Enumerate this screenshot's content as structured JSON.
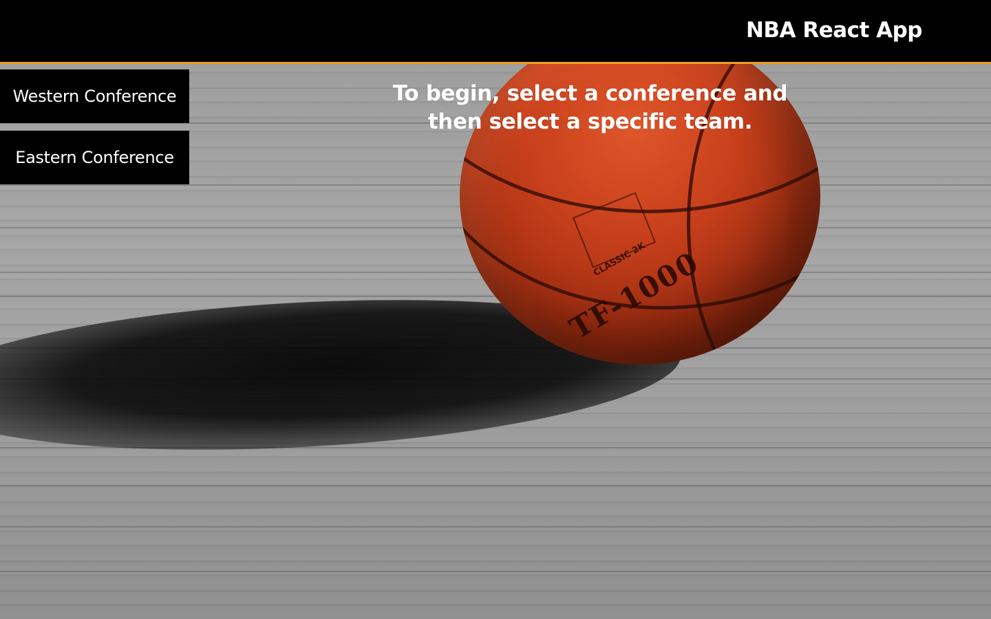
{
  "header": {
    "title": "NBA React App"
  },
  "sidebar": {
    "buttons": [
      {
        "label": "Western Conference"
      },
      {
        "label": "Eastern Conference"
      }
    ]
  },
  "main": {
    "instructions": "To begin, select a conference and then select a specific team."
  },
  "background": {
    "ball_brand_text": "TF-1000",
    "ball_sub_text": "CLASSIC 2K",
    "icon": "basketball-on-court-image"
  },
  "colors": {
    "header_bg": "#000000",
    "header_accent": "#f0a020",
    "button_bg": "#000000",
    "text": "#ffffff"
  }
}
